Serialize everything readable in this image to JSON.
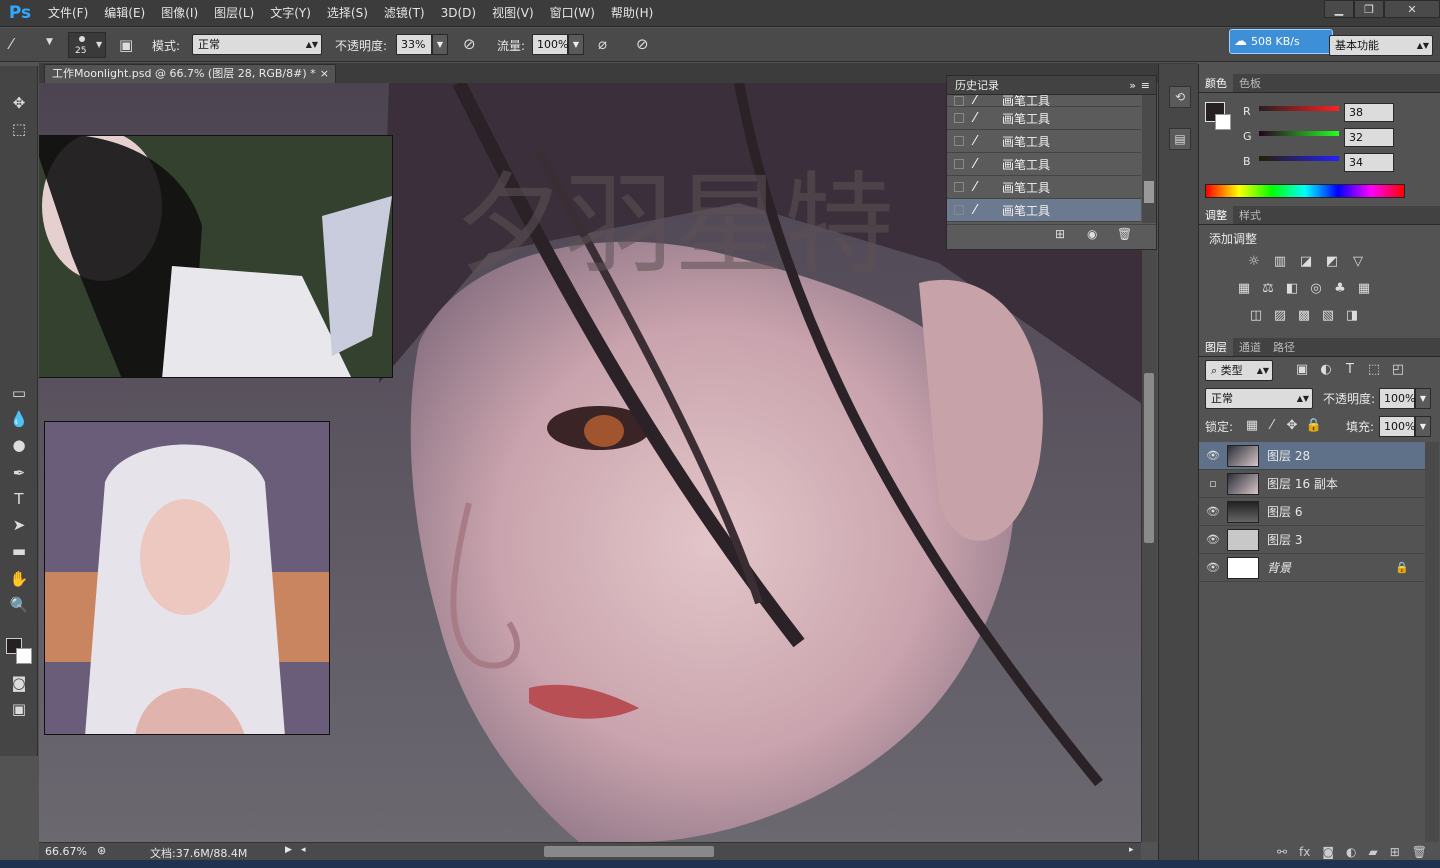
{
  "app": {
    "logo": "Ps"
  },
  "menu": [
    "文件(F)",
    "编辑(E)",
    "图像(I)",
    "图层(L)",
    "文字(Y)",
    "选择(S)",
    "滤镜(T)",
    "3D(D)",
    "视图(V)",
    "窗口(W)",
    "帮助(H)"
  ],
  "options": {
    "brush_size": "25",
    "mode_label": "模式:",
    "mode_value": "正常",
    "opacity_label": "不透明度:",
    "opacity_value": "33%",
    "flow_label": "流量:",
    "flow_value": "100%"
  },
  "network": {
    "speed": "508 KB/s"
  },
  "workspace": {
    "value": "基本功能"
  },
  "document": {
    "tab_title": "工作Moonlight.psd @ 66.7% (图层 28, RGB/8#) *",
    "close": "×"
  },
  "canvas": {
    "watermark": "夕羽星特"
  },
  "history": {
    "title": "历史记录",
    "partial_item": "画笔工具",
    "items": [
      "画笔工具",
      "画笔工具",
      "画笔工具",
      "画笔工具",
      "画笔工具"
    ]
  },
  "color_panel": {
    "tabs": [
      "颜色",
      "色板"
    ],
    "channels": [
      {
        "name": "R",
        "value": "38"
      },
      {
        "name": "G",
        "value": "32"
      },
      {
        "name": "B",
        "value": "34"
      }
    ],
    "foreground": "#262022",
    "background": "#ffffff"
  },
  "adjust_panel": {
    "tabs": [
      "调整",
      "样式"
    ],
    "heading": "添加调整"
  },
  "layers_panel": {
    "tabs": [
      "图层",
      "通道",
      "路径"
    ],
    "filter_kind": "类型",
    "blend_mode": "正常",
    "opacity_label": "不透明度:",
    "opacity_value": "100%",
    "lock_label": "锁定:",
    "fill_label": "填充:",
    "fill_value": "100%",
    "layers": [
      {
        "name": "图层 28",
        "visible": true,
        "selected": true
      },
      {
        "name": "图层 16 副本",
        "visible": false,
        "selected": false
      },
      {
        "name": "图层 6",
        "visible": true,
        "selected": false
      },
      {
        "name": "图层 3",
        "visible": true,
        "selected": false
      },
      {
        "name": "背景",
        "visible": true,
        "selected": false,
        "locked": true
      }
    ]
  },
  "status": {
    "zoom": "66.67%",
    "doc": "文档:37.6M/88.4M"
  }
}
